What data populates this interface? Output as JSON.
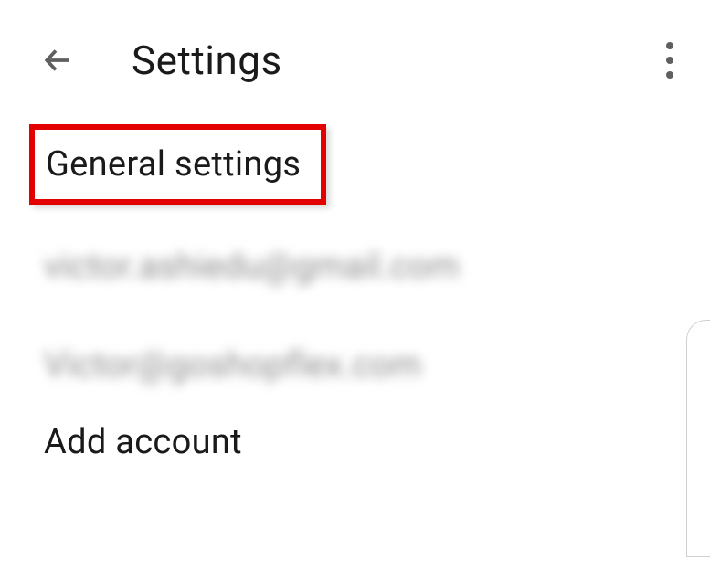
{
  "header": {
    "title": "Settings"
  },
  "items": {
    "general": "General settings",
    "account1": "victor.ashiedu@gmail.com",
    "account2": "Victor@goshopflex.com",
    "add": "Add account"
  }
}
